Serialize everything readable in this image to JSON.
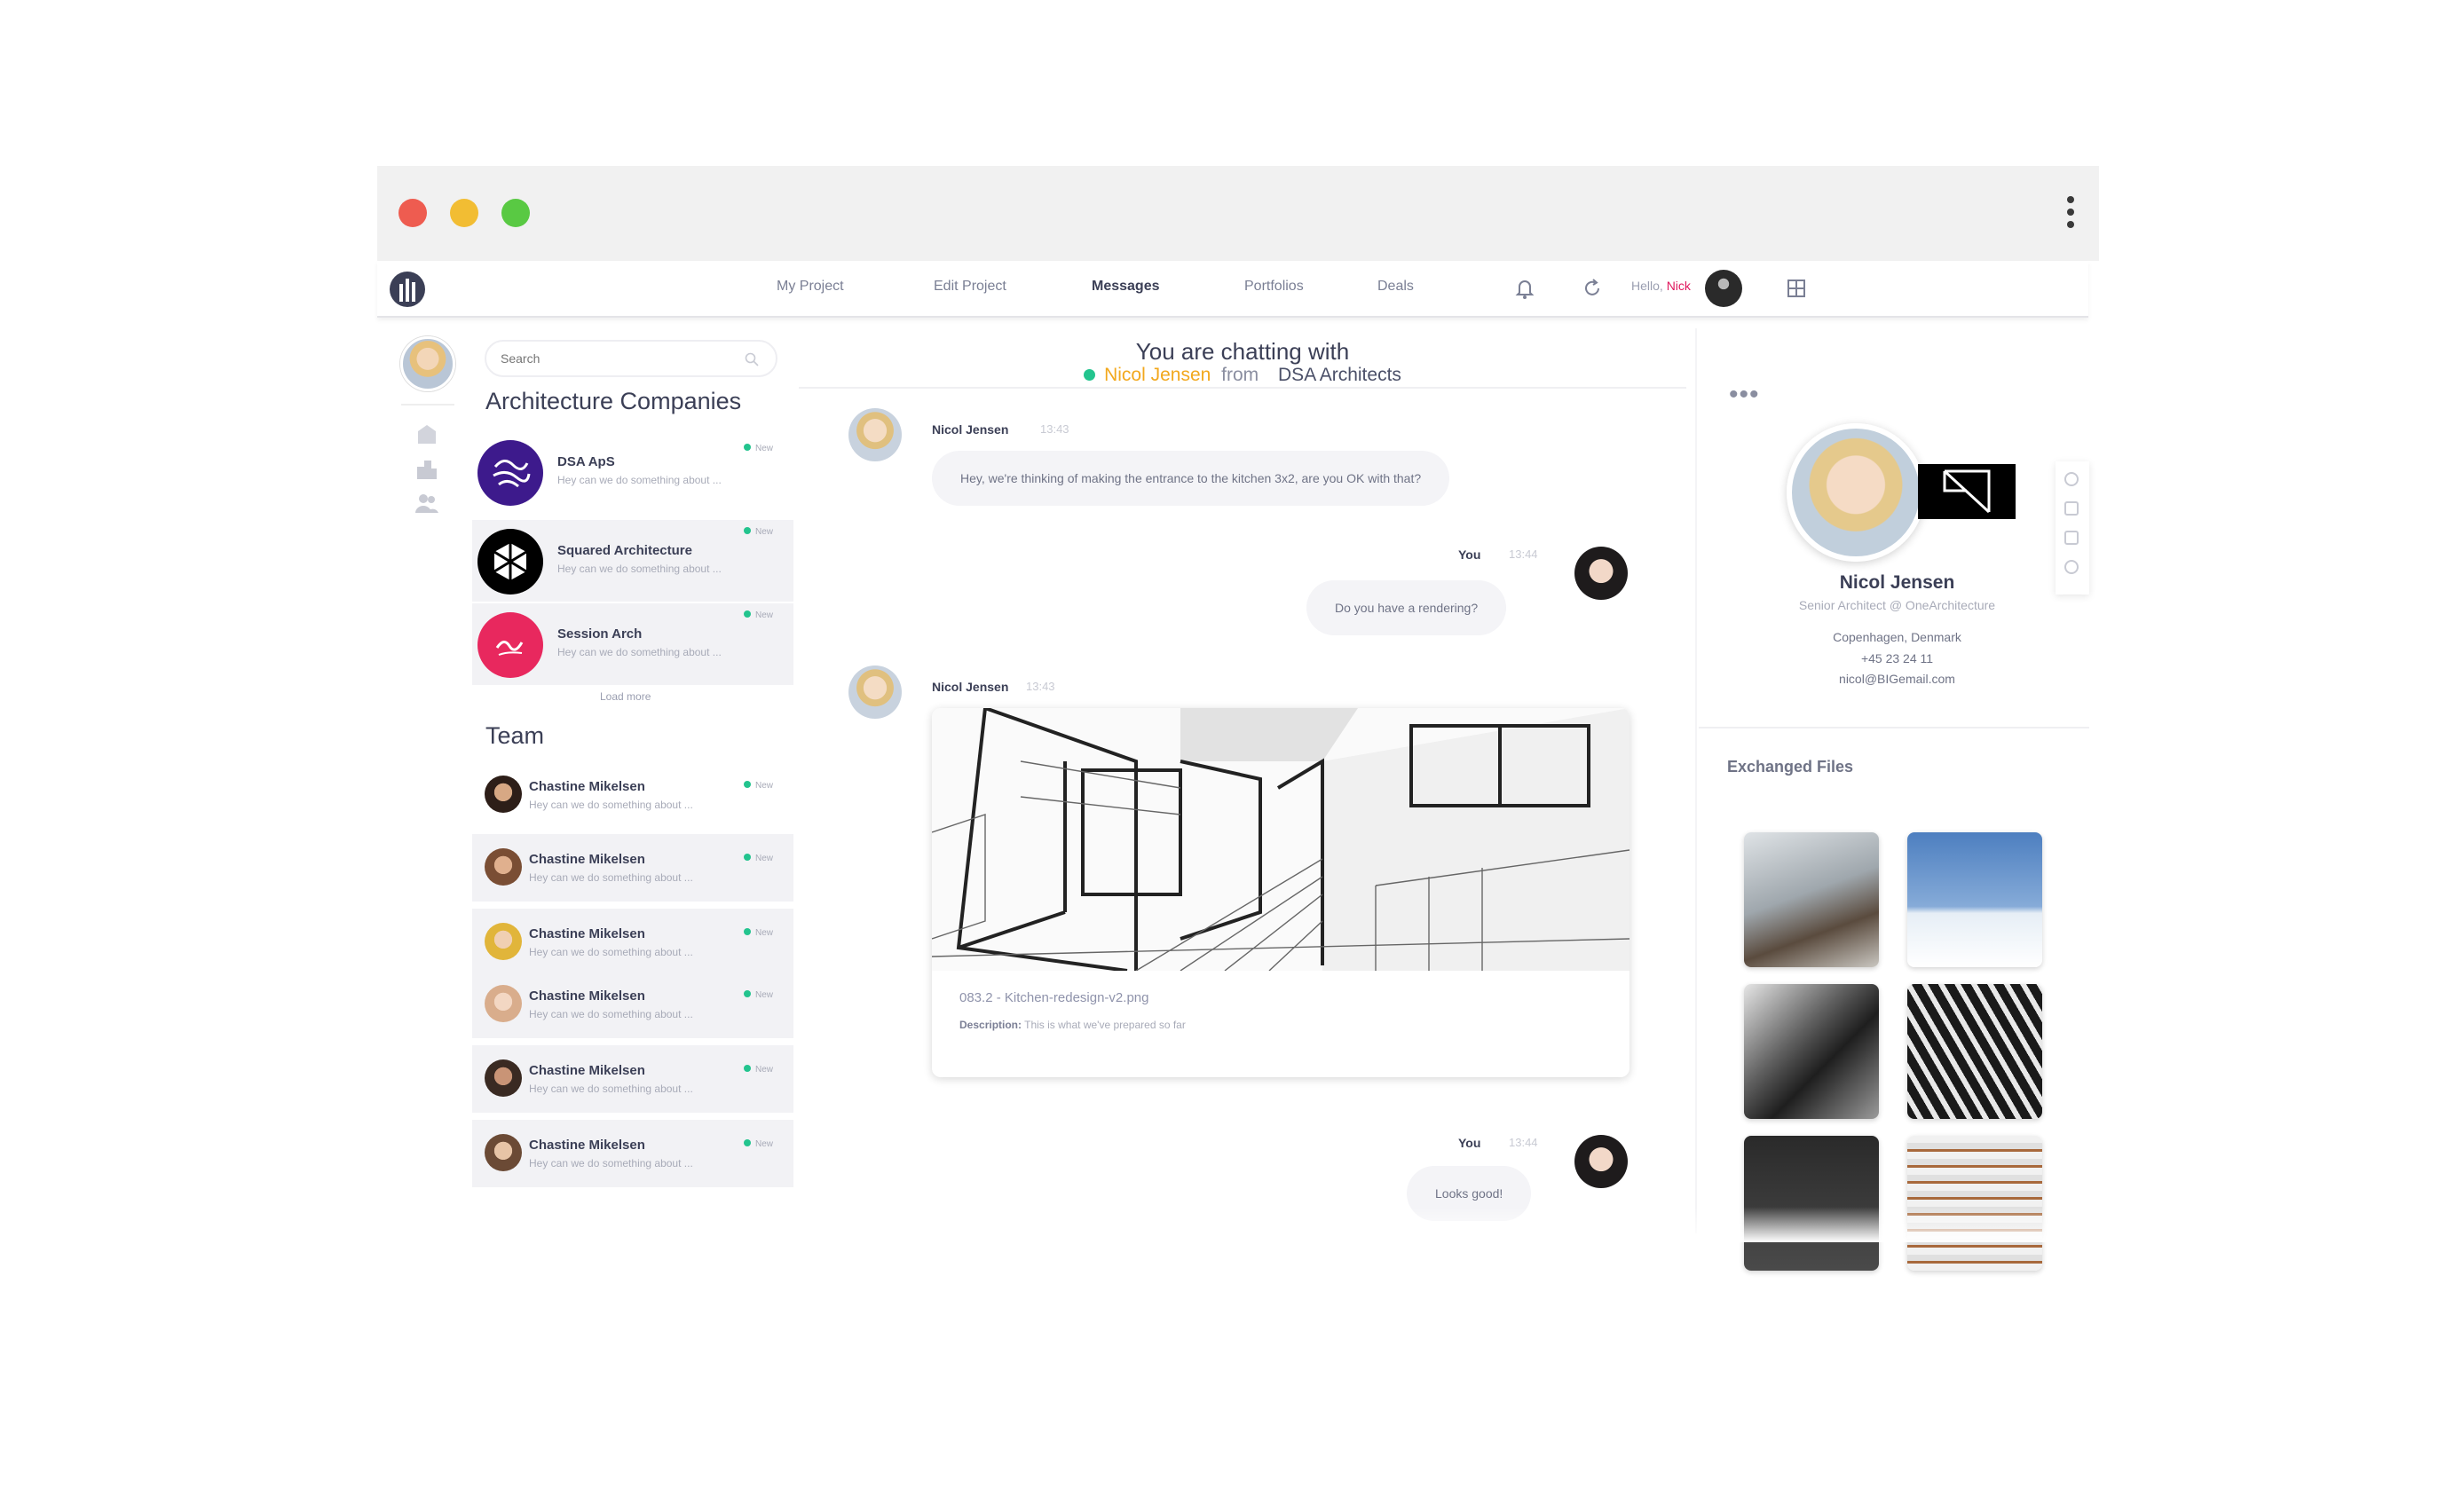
{
  "nav": {
    "links": [
      "My Project",
      "Edit Project",
      "Messages",
      "Portfolios",
      "Deals"
    ],
    "hello": "Hello,",
    "user_name": "Nick"
  },
  "sidebar": {
    "search_placeholder": "Search",
    "companies_title": "Architecture Companies",
    "companies": [
      {
        "name": "DSA ApS",
        "preview": "Hey can we do something about ...",
        "badge": "New"
      },
      {
        "name": "Squared Architecture",
        "preview": "Hey can we do something about ...",
        "badge": "New"
      },
      {
        "name": "Session Arch",
        "preview": "Hey can we do something about ...",
        "badge": "New"
      }
    ],
    "load_more": "Load more",
    "team_title": "Team",
    "team": [
      {
        "name": "Chastine Mikelsen",
        "preview": "Hey can we do something about ...",
        "badge": "New"
      },
      {
        "name": "Chastine Mikelsen",
        "preview": "Hey can we do something about ...",
        "badge": "New"
      },
      {
        "name": "Chastine Mikelsen",
        "preview": "Hey can we do something about ...",
        "badge": "New"
      },
      {
        "name": "Chastine Mikelsen",
        "preview": "Hey can we do something about ...",
        "badge": "New"
      },
      {
        "name": "Chastine Mikelsen",
        "preview": "Hey can we do something about ...",
        "badge": "New"
      },
      {
        "name": "Chastine Mikelsen",
        "preview": "Hey can we do something about ...",
        "badge": "New"
      }
    ]
  },
  "chat": {
    "heading": "You are chatting with",
    "partner_name": "Nicol Jensen",
    "from_label": "from",
    "partner_org": "DSA Architects",
    "messages": [
      {
        "sender": "Nicol Jensen",
        "time": "13:43",
        "text": "Hey, we're thinking of making the entrance to the kitchen 3x2, are you OK with that?"
      },
      {
        "sender": "You",
        "time": "13:44",
        "text": "Do you have a rendering?"
      },
      {
        "sender": "Nicol Jensen",
        "time": "13:43",
        "file_name": "083.2 - Kitchen-redesign-v2.png",
        "desc_label": "Description:",
        "desc_text": "This is what we've prepared so far"
      },
      {
        "sender": "You",
        "time": "13:44",
        "text": "Looks good!"
      }
    ]
  },
  "profile": {
    "name": "Nicol Jensen",
    "title": "Senior Architect @ OneArchitecture",
    "location": "Copenhagen, Denmark",
    "phone": "+45 23 24 11",
    "email": "nicol@BIGemail.com",
    "files_title": "Exchanged Files"
  },
  "colors": {
    "accent_orange": "#f2a81d",
    "accent_pink": "#e0185e",
    "online_green": "#23c48e",
    "text_dark": "#3b3f56"
  }
}
